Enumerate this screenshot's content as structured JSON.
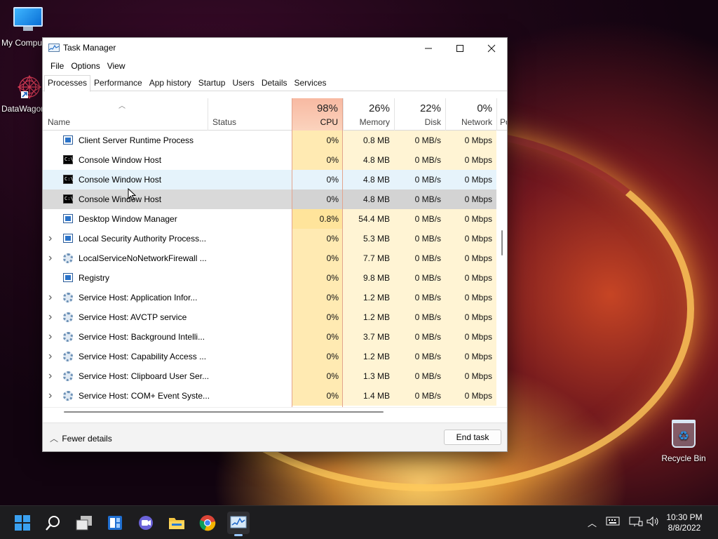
{
  "desktop": {
    "icons": [
      {
        "label": "My Compu"
      },
      {
        "label": "DataWagor"
      },
      {
        "label": "Recycle Bin"
      }
    ]
  },
  "window": {
    "title": "Task Manager",
    "menu": [
      "File",
      "Options",
      "View"
    ],
    "tabs": [
      "Processes",
      "Performance",
      "App history",
      "Startup",
      "Users",
      "Details",
      "Services"
    ],
    "active_tab": "Processes"
  },
  "table": {
    "headers": {
      "name": "Name",
      "status": "Status",
      "cpu_pct": "98%",
      "cpu": "CPU",
      "mem_pct": "26%",
      "mem": "Memory",
      "disk_pct": "22%",
      "disk": "Disk",
      "net_pct": "0%",
      "net": "Network",
      "power": "Po"
    },
    "rows": [
      {
        "name": "Client Server Runtime Process",
        "icon": "app",
        "expand": false,
        "cpu": "0%",
        "mem": "0.8 MB",
        "disk": "0 MB/s",
        "net": "0 Mbps"
      },
      {
        "name": "Console Window Host",
        "icon": "cmd",
        "expand": false,
        "cpu": "0%",
        "mem": "4.8 MB",
        "disk": "0 MB/s",
        "net": "0 Mbps"
      },
      {
        "name": "Console Window Host",
        "icon": "cmd",
        "expand": false,
        "cpu": "0%",
        "mem": "4.8 MB",
        "disk": "0 MB/s",
        "net": "0 Mbps"
      },
      {
        "name": "Console Window Host",
        "icon": "cmd",
        "expand": false,
        "cpu": "0%",
        "mem": "4.8 MB",
        "disk": "0 MB/s",
        "net": "0 Mbps"
      },
      {
        "name": "Desktop Window Manager",
        "icon": "app",
        "expand": false,
        "cpu": "0.8%",
        "mem": "54.4 MB",
        "disk": "0 MB/s",
        "net": "0 Mbps"
      },
      {
        "name": "Local Security Authority Process...",
        "icon": "app",
        "expand": true,
        "cpu": "0%",
        "mem": "5.3 MB",
        "disk": "0 MB/s",
        "net": "0 Mbps"
      },
      {
        "name": "LocalServiceNoNetworkFirewall ...",
        "icon": "gear",
        "expand": true,
        "cpu": "0%",
        "mem": "7.7 MB",
        "disk": "0 MB/s",
        "net": "0 Mbps"
      },
      {
        "name": "Registry",
        "icon": "app",
        "expand": false,
        "cpu": "0%",
        "mem": "9.8 MB",
        "disk": "0 MB/s",
        "net": "0 Mbps"
      },
      {
        "name": "Service Host: Application Infor...",
        "icon": "gear",
        "expand": true,
        "cpu": "0%",
        "mem": "1.2 MB",
        "disk": "0 MB/s",
        "net": "0 Mbps"
      },
      {
        "name": "Service Host: AVCTP service",
        "icon": "gear",
        "expand": true,
        "cpu": "0%",
        "mem": "1.2 MB",
        "disk": "0 MB/s",
        "net": "0 Mbps"
      },
      {
        "name": "Service Host: Background Intelli...",
        "icon": "gear",
        "expand": true,
        "cpu": "0%",
        "mem": "3.7 MB",
        "disk": "0 MB/s",
        "net": "0 Mbps"
      },
      {
        "name": "Service Host: Capability Access ...",
        "icon": "gear",
        "expand": true,
        "cpu": "0%",
        "mem": "1.2 MB",
        "disk": "0 MB/s",
        "net": "0 Mbps"
      },
      {
        "name": "Service Host: Clipboard User Ser...",
        "icon": "gear",
        "expand": true,
        "cpu": "0%",
        "mem": "1.3 MB",
        "disk": "0 MB/s",
        "net": "0 Mbps"
      },
      {
        "name": "Service Host: COM+ Event Syste...",
        "icon": "gear",
        "expand": true,
        "cpu": "0%",
        "mem": "1.4 MB",
        "disk": "0 MB/s",
        "net": "0 Mbps"
      }
    ],
    "hover_row": 2,
    "selected_row": 3
  },
  "footer": {
    "fewer_details": "Fewer details",
    "end_task": "End task"
  },
  "taskbar": {
    "time": "10:30 PM",
    "date": "8/8/2022",
    "apps": [
      "start-icon",
      "search-icon",
      "task-view-icon",
      "widgets-icon",
      "chat-icon",
      "file-explorer-icon",
      "chrome-icon",
      "task-manager-icon"
    ]
  }
}
